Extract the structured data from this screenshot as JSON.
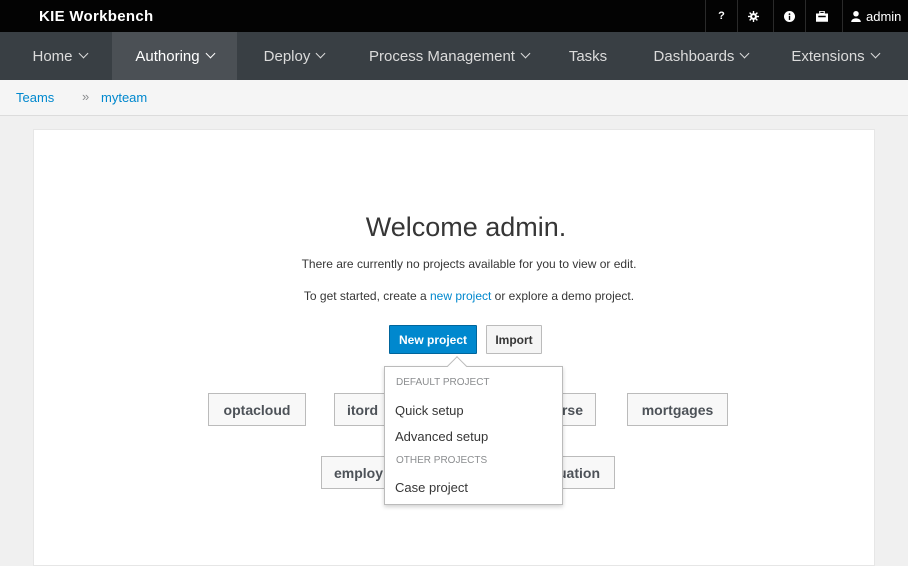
{
  "app": {
    "title": "KIE Workbench"
  },
  "utility": {
    "help_label": "?",
    "settings_icon": "gear-icon",
    "info_icon": "info-icon",
    "apps_icon": "briefcase-icon",
    "user_icon": "user-icon",
    "user_label": "admin"
  },
  "nav": {
    "items": [
      {
        "label": "Home",
        "has_menu": true
      },
      {
        "label": "Authoring",
        "has_menu": true,
        "active": true
      },
      {
        "label": "Deploy",
        "has_menu": true
      },
      {
        "label": "Process Management",
        "has_menu": true
      },
      {
        "label": "Tasks",
        "has_menu": false
      },
      {
        "label": "Dashboards",
        "has_menu": true
      },
      {
        "label": "Extensions",
        "has_menu": true
      }
    ]
  },
  "breadcrumb": {
    "items": [
      "Teams",
      "myteam"
    ],
    "separator": "»"
  },
  "welcome": {
    "title": "Welcome admin.",
    "line1": "There are currently no projects available for you to view or edit.",
    "line2_prefix": "To get started, create a ",
    "line2_link": "new project",
    "line2_suffix": " or explore a demo project."
  },
  "actions": {
    "new_project_label": "New project",
    "import_label": "Import"
  },
  "demo_projects": [
    "optacloud",
    "itord",
    "rse",
    "mortgages",
    "employ",
    "uation"
  ],
  "dropdown": {
    "default_header": "DEFAULT PROJECT",
    "quick_setup": "Quick setup",
    "advanced_setup": "Advanced setup",
    "other_header": "OTHER PROJECTS",
    "case_project": "Case project"
  },
  "colors": {
    "topbar_bg": "#030303",
    "navbar_bg": "#393f44",
    "nav_active_bg": "#4b5055",
    "primary": "#0088ce",
    "link": "#0088ce"
  }
}
